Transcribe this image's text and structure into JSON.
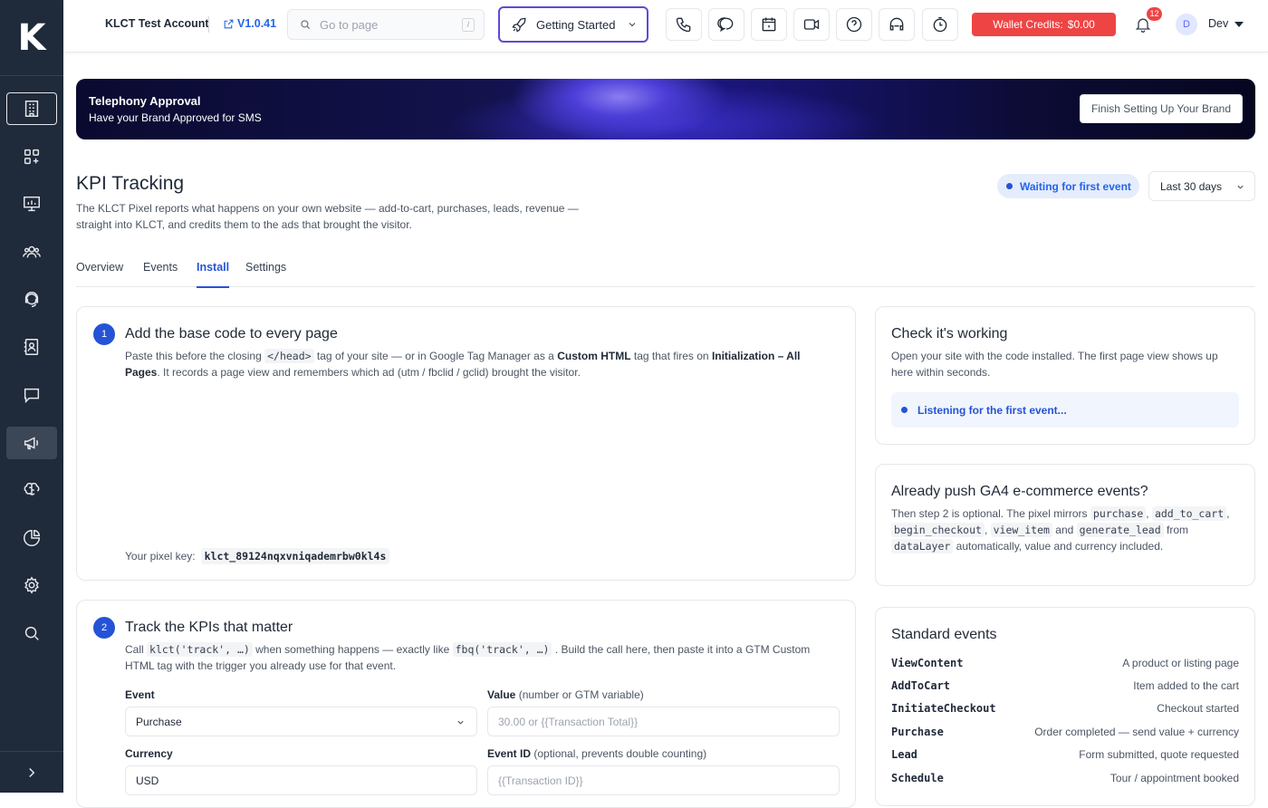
{
  "sidebar": {
    "logo": "K",
    "items": [
      {
        "icon": "building-icon"
      },
      {
        "icon": "apps-grid-icon"
      },
      {
        "icon": "presentation-icon"
      },
      {
        "icon": "users-icon"
      },
      {
        "icon": "support-agent-icon"
      },
      {
        "icon": "contact-book-icon"
      },
      {
        "icon": "chat-icon"
      },
      {
        "icon": "megaphone-icon"
      },
      {
        "icon": "brain-icon"
      },
      {
        "icon": "pie-chart-icon"
      },
      {
        "icon": "settings-icon"
      },
      {
        "icon": "search-icon"
      }
    ],
    "active_index": 7
  },
  "header": {
    "account": "KLCT Test Account",
    "version": "V1.0.41",
    "search_placeholder": "Go to page",
    "search_shortcut": "/",
    "getting_started": "Getting Started",
    "wallet_label": "Wallet Credits:",
    "wallet_value": "$0.00",
    "notifications": "12",
    "avatar_initial": "D",
    "user_name": "Dev"
  },
  "banner": {
    "title": "Telephony Approval",
    "subtitle": "Have your Brand Approved for SMS",
    "button": "Finish Setting Up Your Brand"
  },
  "page": {
    "title": "KPI Tracking",
    "description": "The KLCT Pixel reports what happens on your own website — add-to-cart, purchases, leads, revenue — straight into KLCT, and credits them to the ads that brought the visitor.",
    "status": "Waiting for first event",
    "range": "Last 30 days",
    "tabs": [
      "Overview",
      "Events",
      "Install",
      "Settings"
    ],
    "active_tab": 2
  },
  "step1": {
    "num": "1",
    "title": "Add the base code to every page",
    "t1": "Paste this before the closing",
    "code1": "</head>",
    "t2": "tag of your site — or in Google Tag Manager as a",
    "b1": "Custom HTML",
    "t3": "tag that fires on",
    "b2": "Initialization – All Pages",
    "t4": ". It records a page view and remembers which ad (utm / fbclid / gclid) brought the visitor.",
    "key_label": "Your pixel key:",
    "key_value": "klct_89124nqxvniqademrbw0kl4s"
  },
  "step2": {
    "num": "2",
    "title": "Track the KPIs that matter",
    "t1": "Call",
    "code1": "klct('track', …)",
    "t2": "when something happens — exactly like",
    "code2": "fbq('track', …)",
    "t3": ". Build the call here, then paste it into a GTM Custom HTML tag with the trigger you already use for that event.",
    "event_label": "Event",
    "event_value": "Purchase",
    "value_label": "Value",
    "value_hint": "(number or GTM variable)",
    "value_placeholder": "30.00 or {{Transaction Total}}",
    "currency_label": "Currency",
    "currency_value": "USD",
    "eventid_label": "Event ID",
    "eventid_hint": "(optional, prevents double counting)",
    "eventid_placeholder": "{{Transaction ID}}"
  },
  "check": {
    "title": "Check it's working",
    "text": "Open your site with the code installed. The first page view shows up here within seconds.",
    "listening": "Listening for the first event..."
  },
  "ga4": {
    "title": "Already push GA4 e-commerce events?",
    "t1": "Then step 2 is optional. The pixel mirrors",
    "c1": "purchase",
    "c2": "add_to_cart",
    "c3": "begin_checkout",
    "c4": "view_item",
    "and": "and",
    "c5": "generate_lead",
    "from": "from",
    "c6": "dataLayer",
    "t2": "automatically, value and currency included."
  },
  "standard": {
    "title": "Standard events",
    "rows": [
      {
        "name": "ViewContent",
        "desc": "A product or listing page"
      },
      {
        "name": "AddToCart",
        "desc": "Item added to the cart"
      },
      {
        "name": "InitiateCheckout",
        "desc": "Checkout started"
      },
      {
        "name": "Purchase",
        "desc": "Order completed — send value + currency"
      },
      {
        "name": "Lead",
        "desc": "Form submitted, quote requested"
      },
      {
        "name": "Schedule",
        "desc": "Tour / appointment booked"
      }
    ]
  },
  "colors": {
    "accent": "#2553d6",
    "sidebar": "#1f2a3a",
    "wallet": "#ef4444"
  }
}
